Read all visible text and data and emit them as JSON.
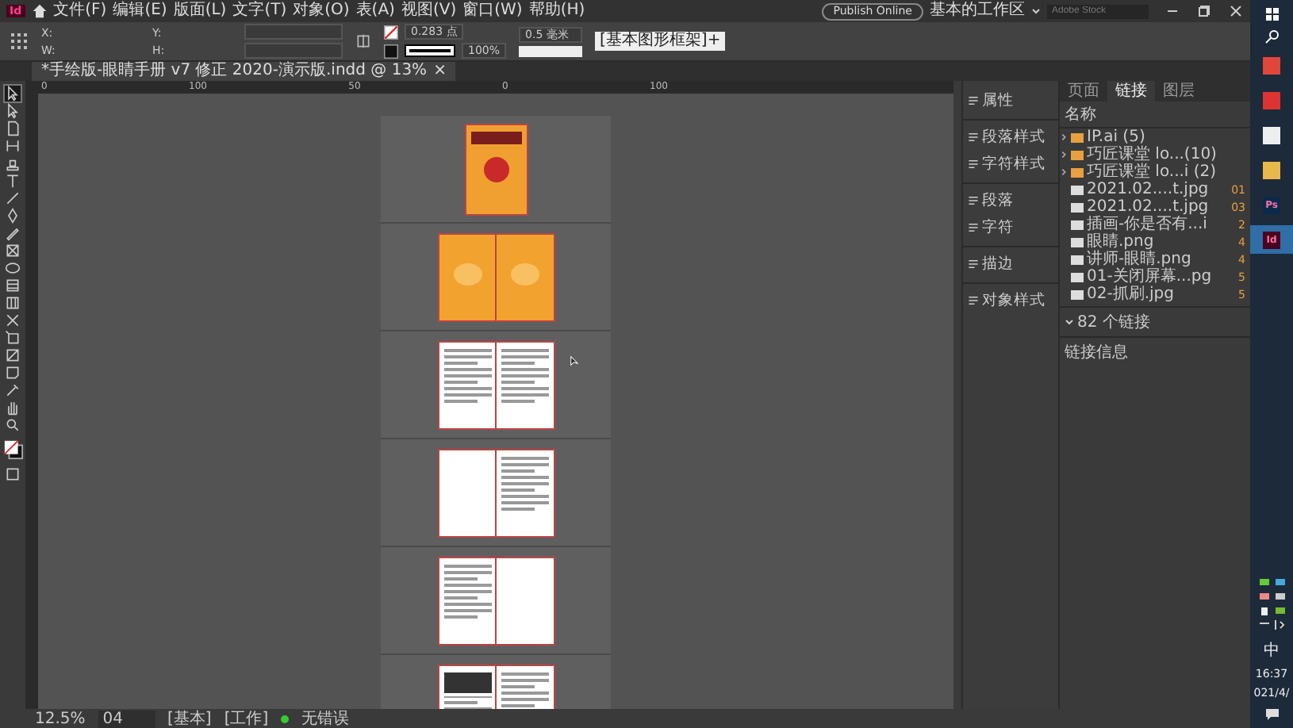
{
  "menu_bar": {
    "app_logo": "Id",
    "menus": [
      "文件(F)",
      "编辑(E)",
      "版面(L)",
      "文字(T)",
      "对象(O)",
      "表(A)",
      "视图(V)",
      "窗口(W)",
      "帮助(H)"
    ],
    "publish_button": "Publish Online",
    "workspace": "基本的工作区",
    "search": {
      "placeholder": "Adobe Stock"
    }
  },
  "control_bar": {
    "labels": [
      "X:",
      "Y:",
      "W:",
      "H:"
    ],
    "stroke_weight": "0.283 点",
    "scale": "100%",
    "gap": "0.5 毫米",
    "object_style": "[基本图形框架]+"
  },
  "document_tab": {
    "title": "*手绘版-眼睛手册 v7 修正 2020-演示版.indd @ 13%",
    "close": "×"
  },
  "tools": [
    {
      "kind": "select",
      "selected": true
    },
    {
      "kind": "direct",
      "selected": false
    },
    {
      "kind": "page",
      "selected": false
    },
    {
      "kind": "gap",
      "selected": false
    },
    {
      "kind": "content",
      "selected": false
    },
    {
      "kind": "type",
      "selected": false
    },
    {
      "kind": "line",
      "selected": false
    },
    {
      "kind": "pen",
      "selected": false
    },
    {
      "kind": "pencil",
      "selected": false
    },
    {
      "kind": "frame",
      "selected": false
    },
    {
      "kind": "ellipse",
      "selected": false
    },
    {
      "kind": "rect",
      "selected": false
    },
    {
      "kind": "grid",
      "selected": false
    },
    {
      "kind": "scissors",
      "selected": false
    },
    {
      "kind": "transform",
      "selected": false
    },
    {
      "kind": "gradient",
      "selected": false
    },
    {
      "kind": "note",
      "selected": false
    },
    {
      "kind": "eyedropper",
      "selected": false
    },
    {
      "kind": "hand",
      "selected": false
    },
    {
      "kind": "zoom",
      "selected": false
    }
  ],
  "ruler": {
    "labels": [
      "0",
      "100",
      "50",
      "0",
      "100"
    ]
  },
  "spreads": [
    {
      "pages": [
        {
          "kind": "cover"
        }
      ]
    },
    {
      "pages": [
        {
          "kind": "orange"
        },
        {
          "kind": "orange"
        }
      ]
    },
    {
      "pages": [
        {
          "kind": "text"
        },
        {
          "kind": "text"
        }
      ]
    },
    {
      "pages": [
        {
          "kind": "blank"
        },
        {
          "kind": "text"
        }
      ]
    },
    {
      "pages": [
        {
          "kind": "text"
        },
        {
          "kind": "blank"
        }
      ]
    },
    {
      "pages": [
        {
          "kind": "photo"
        },
        {
          "kind": "text"
        }
      ]
    }
  ],
  "side_panels": [
    {
      "label": "属性",
      "divider_before": false
    },
    {
      "label": "段落样式",
      "divider_before": true
    },
    {
      "label": "字符样式",
      "divider_before": false
    },
    {
      "label": "段落",
      "divider_before": true
    },
    {
      "label": "字符",
      "divider_before": false
    },
    {
      "label": "描边",
      "divider_before": true
    },
    {
      "label": "对象样式",
      "divider_before": true
    }
  ],
  "links_panel": {
    "tabs": [
      {
        "label": "页面",
        "selected": false
      },
      {
        "label": "链接",
        "selected": true
      },
      {
        "label": "图层",
        "selected": false
      }
    ],
    "header": "名称",
    "rows": [
      {
        "kind": "group",
        "name": "IP.ai (5)",
        "page": ""
      },
      {
        "kind": "group",
        "name": "巧匠课堂 lo...(10)",
        "page": ""
      },
      {
        "kind": "group",
        "name": "巧匠课堂 lo...i (2)",
        "page": ""
      },
      {
        "kind": "file",
        "name": "2021.02....t.jpg",
        "page": "01"
      },
      {
        "kind": "file",
        "name": "2021.02....t.jpg",
        "page": "03"
      },
      {
        "kind": "file",
        "name": "插画-你是否有...i",
        "page": "2"
      },
      {
        "kind": "file",
        "name": "眼睛.png",
        "page": "4"
      },
      {
        "kind": "file",
        "name": "讲师-眼睛.png",
        "page": "4"
      },
      {
        "kind": "file",
        "name": "01-关闭屏幕...pg",
        "page": "5"
      },
      {
        "kind": "file",
        "name": "02-抓刷.jpg",
        "page": "5"
      }
    ],
    "count": "82 个链接",
    "info": "链接信息"
  },
  "status_bar": {
    "zoom": "12.5%",
    "page": "04",
    "master": "[基本]",
    "mode": "[工作]",
    "preflight": "无错误"
  },
  "taskbar": {
    "apps": [
      {
        "kind": "chrome",
        "selected": false
      },
      {
        "kind": "wps",
        "selected": false
      },
      {
        "kind": "doc",
        "selected": false
      },
      {
        "kind": "folder",
        "selected": false
      },
      {
        "kind": "ps",
        "label": "Ps",
        "selected": false
      },
      {
        "kind": "id",
        "label": "Id",
        "selected": true
      }
    ],
    "ime": "中",
    "time": "16:37",
    "date": "021/4/"
  }
}
